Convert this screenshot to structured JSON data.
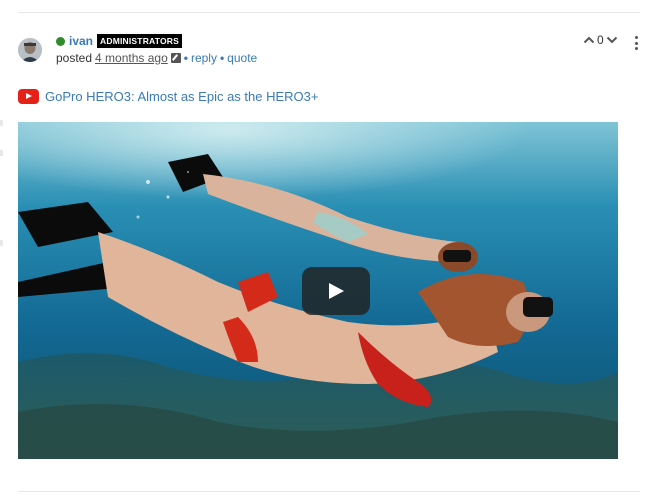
{
  "post": {
    "author": {
      "username": "ivan",
      "status": "online",
      "role_badge": "ADMINISTRATORS"
    },
    "meta": {
      "prefix": "posted",
      "timestamp": "4 months ago",
      "separator": "•",
      "reply_label": "reply",
      "quote_label": "quote"
    },
    "votes": {
      "count": "0"
    },
    "embed": {
      "provider_icon": "youtube-icon",
      "title": "GoPro HERO3: Almost as Epic as the HERO3+"
    }
  },
  "colors": {
    "link": "#3a7bb7",
    "online": "#2e8b2e",
    "badge_bg": "#000000",
    "youtube_red": "#e62117"
  }
}
